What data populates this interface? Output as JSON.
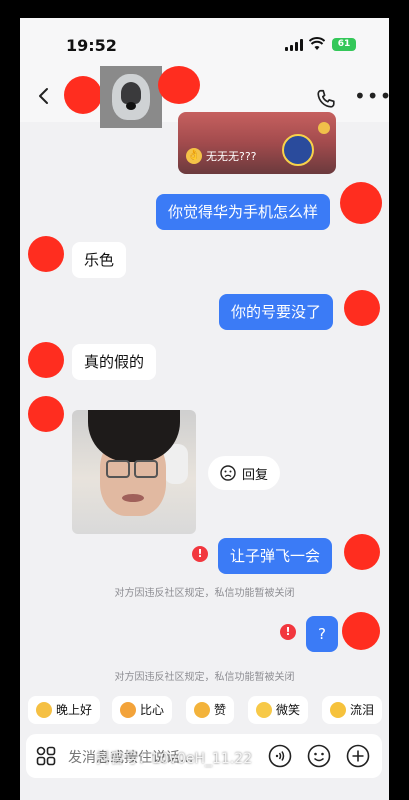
{
  "status": {
    "time": "19:52",
    "battery": "61"
  },
  "header": {
    "back_icon": "chevron-left-icon"
  },
  "prev_card": {
    "caption": "无无无???"
  },
  "messages": {
    "m1": "你觉得华为手机怎么样",
    "m2": "乐色",
    "m3": "你的号要没了",
    "m4": "真的假的",
    "m5": "让子弹飞一会",
    "m6": "?"
  },
  "reply_label": "回复",
  "notices": {
    "n1": "对方因违反社区规定，私信功能暂被关闭",
    "n2": "对方因违反社区规定，私信功能暂被关闭"
  },
  "quick_replies": [
    "晚上好",
    "比心",
    "赞",
    "微笑",
    "流泪"
  ],
  "input": {
    "placeholder": "发消息或按住说话..."
  },
  "watermark": "抖音号：L0v0eH_11.22",
  "colors": {
    "accent": "#3b7bf6",
    "redaction": "#ff2d1f",
    "error": "#f2373e",
    "battery": "#34c759"
  }
}
